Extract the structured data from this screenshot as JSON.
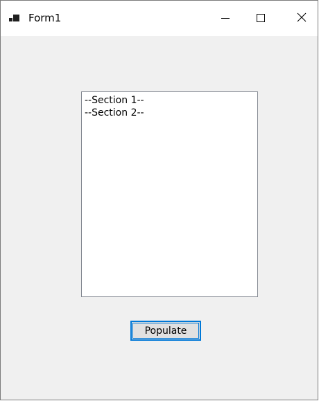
{
  "window": {
    "title": "Form1",
    "icon": "winforms-app-icon",
    "controls": {
      "minimize": "minimize-icon",
      "maximize": "maximize-icon",
      "close": "close-icon"
    }
  },
  "listbox": {
    "items": [
      "--Section 1--",
      "--Section 2--"
    ]
  },
  "populate_button": {
    "label": "Populate"
  },
  "colors": {
    "form_background": "#f0f0f0",
    "button_focus_border": "#0078d7"
  }
}
